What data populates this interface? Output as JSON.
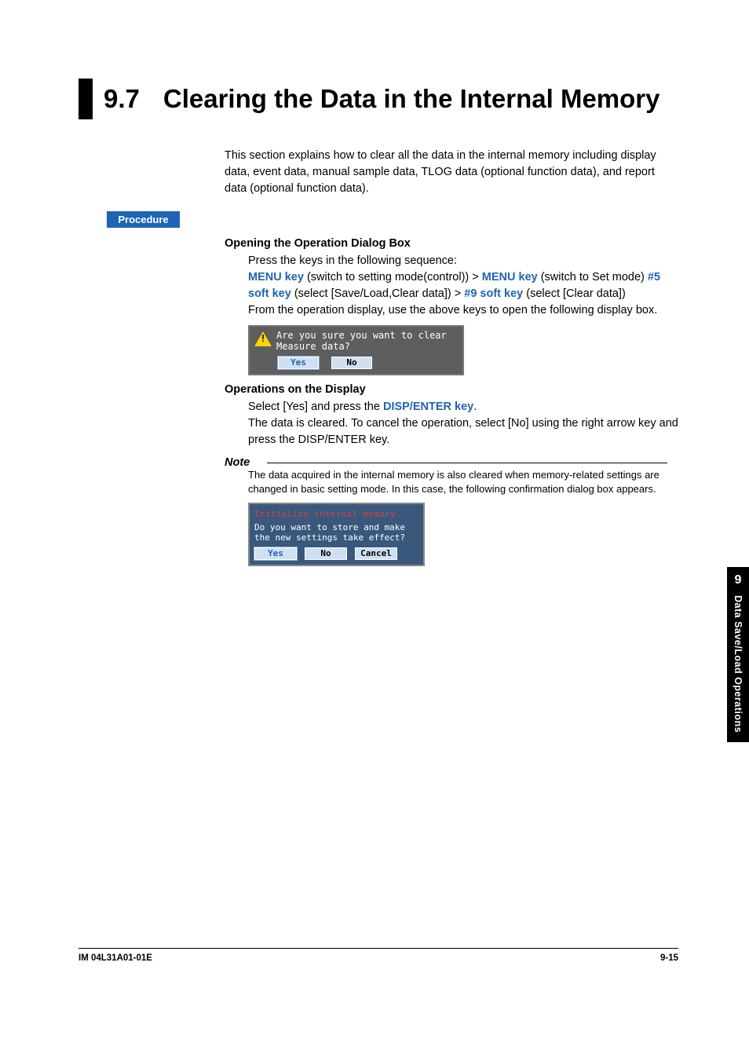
{
  "header": {
    "number": "9.7",
    "title": "Clearing the Data in the Internal Memory"
  },
  "intro": "This section explains how to clear all the data in the internal memory including display data, event data, manual sample data, TLOG data (optional function data), and report data (optional function data).",
  "procedure_label": "Procedure",
  "opening": {
    "heading": "Opening the Operation Dialog Box",
    "line1": "Press the keys in the following sequence:",
    "key1": "MENU key",
    "txt1": " (switch to setting mode(control)) > ",
    "key2": "MENU key",
    "txt2": " (switch to Set mode) ",
    "key3": "#5 soft key",
    "txt3": " (select [Save/Load,Clear data]) > ",
    "key4": "#9 soft key",
    "txt4": " (select [Clear data])",
    "line3": "From the operation display, use the above keys to open the following display box."
  },
  "dialog1": {
    "line1": "Are you sure you want to clear",
    "line2": "Measure data?",
    "yes": "Yes",
    "no": "No"
  },
  "ops": {
    "heading": "Operations on the Display",
    "pre": "Select [Yes] and press the ",
    "key": "DISP/ENTER key",
    "post": ".",
    "line2": "The data is cleared.  To cancel the operation, select [No] using the right arrow key and press the DISP/ENTER key."
  },
  "note": {
    "label": "Note",
    "text": "The data acquired in the internal memory is also cleared when memory-related settings are changed in basic setting mode.  In this case, the following confirmation dialog box appears."
  },
  "dialog2": {
    "title": "Initialize internal memory.",
    "line1": "Do you want to store and make",
    "line2": "the new settings take effect?",
    "yes": "Yes",
    "no": "No",
    "cancel": "Cancel"
  },
  "sidetab": {
    "num": "9",
    "text": "Data Save/Load Operations"
  },
  "footer": {
    "left": "IM 04L31A01-01E",
    "right": "9-15"
  }
}
